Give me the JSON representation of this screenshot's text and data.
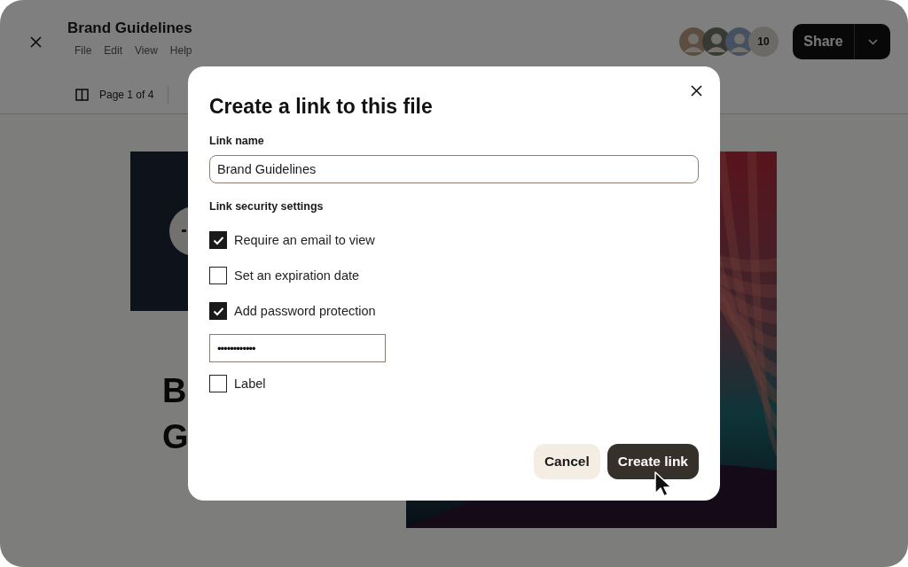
{
  "app": {
    "title": "Brand Guidelines",
    "menu": [
      "File",
      "Edit",
      "View",
      "Help"
    ],
    "page_indicator": "Page 1 of 4",
    "collaborators_count": "10",
    "share_button": "Share"
  },
  "document": {
    "heading_lines": [
      "B",
      "G"
    ]
  },
  "dialog": {
    "title": "Create a link to this file",
    "link_name": {
      "label": "Link name",
      "value": "Brand Guidelines"
    },
    "security_heading": "Link security settings",
    "settings": [
      {
        "kind": "checkbox",
        "label": "Require an email to view",
        "checked": true
      },
      {
        "kind": "checkbox",
        "label": "Set an expiration date",
        "checked": false
      },
      {
        "kind": "checkbox",
        "label": "Add password protection",
        "checked": true
      },
      {
        "kind": "password",
        "value": "••••••••••••"
      },
      {
        "kind": "checkbox",
        "label": "Label",
        "checked": false
      }
    ],
    "buttons": [
      {
        "label": "Cancel",
        "kind": "secondary"
      },
      {
        "label": "Create link",
        "kind": "primary"
      }
    ]
  }
}
